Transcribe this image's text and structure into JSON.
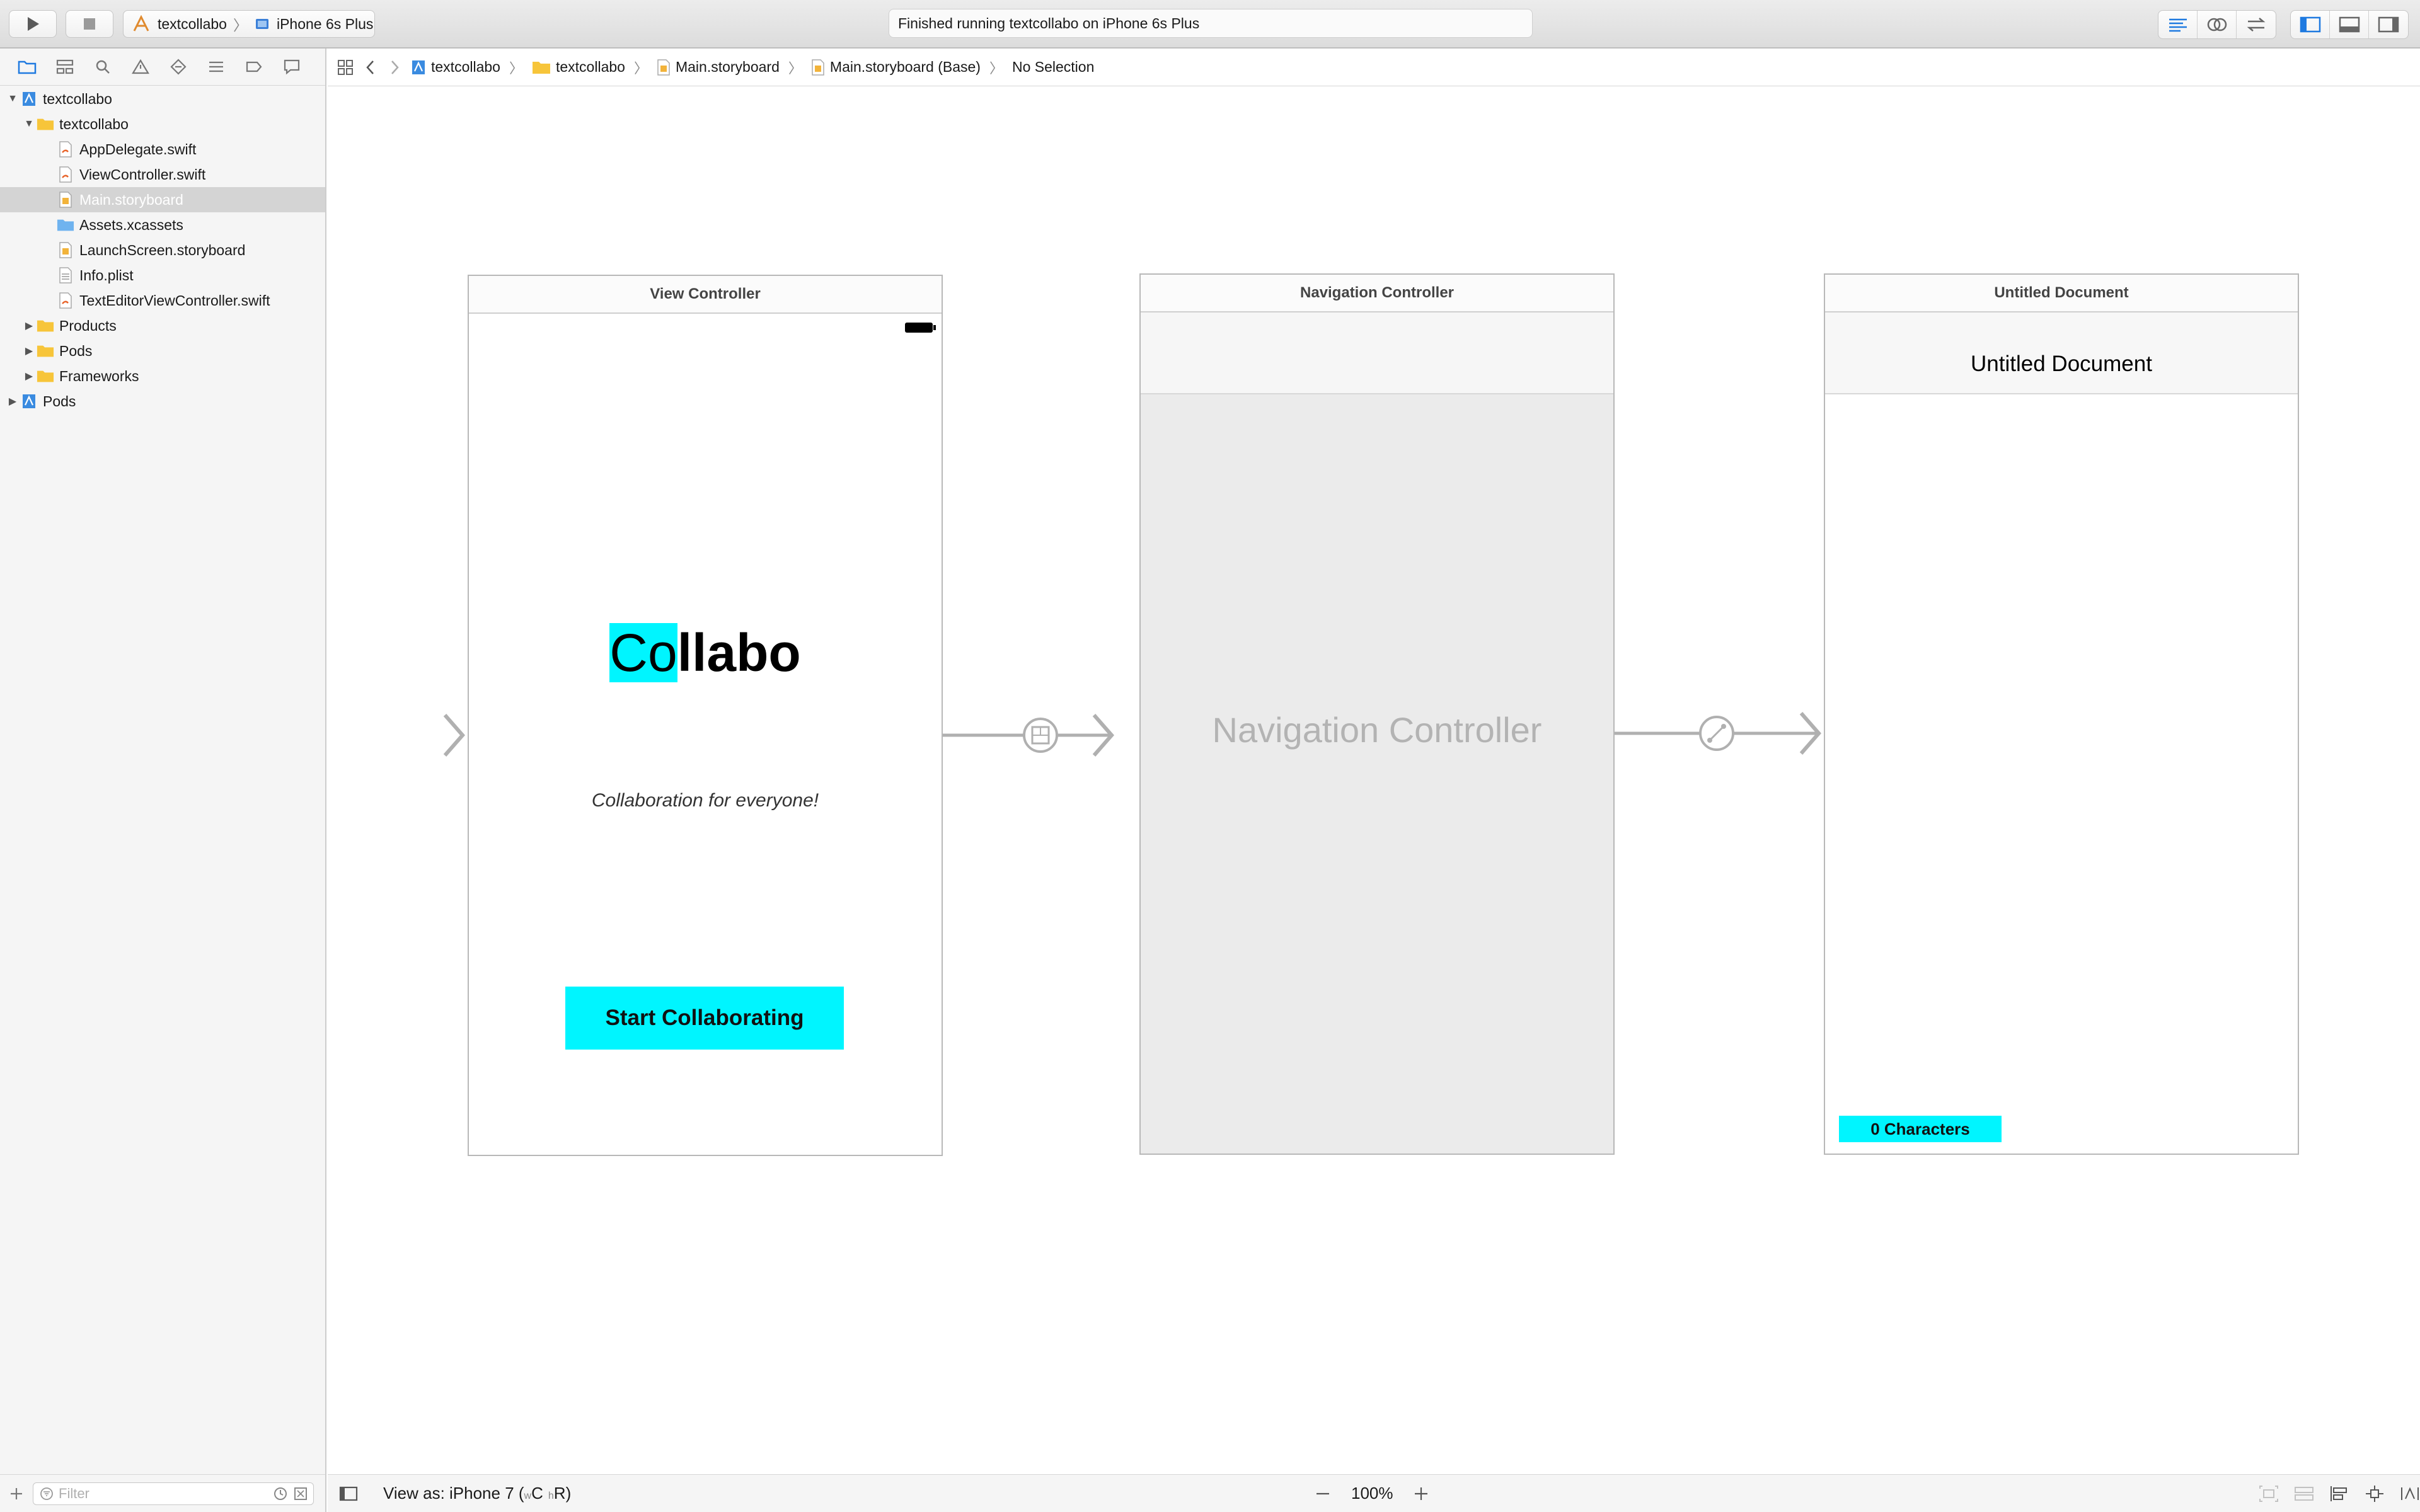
{
  "toolbar": {
    "scheme_name": "textcollabo",
    "device_name": "iPhone 6s Plus",
    "status": "Finished running textcollabo on iPhone 6s Plus"
  },
  "navigator": {
    "items": [
      {
        "label": "textcollabo",
        "icon": "project-icon"
      },
      {
        "label": "textcollabo",
        "icon": "folder-icon"
      },
      {
        "label": "AppDelegate.swift",
        "icon": "swift-file-icon"
      },
      {
        "label": "ViewController.swift",
        "icon": "swift-file-icon"
      },
      {
        "label": "Main.storyboard",
        "icon": "storyboard-file-icon"
      },
      {
        "label": "Assets.xcassets",
        "icon": "assets-folder-icon"
      },
      {
        "label": "LaunchScreen.storyboard",
        "icon": "storyboard-file-icon"
      },
      {
        "label": "Info.plist",
        "icon": "plist-file-icon"
      },
      {
        "label": "TextEditorViewController.swift",
        "icon": "swift-file-icon"
      },
      {
        "label": "Products",
        "icon": "folder-icon"
      },
      {
        "label": "Pods",
        "icon": "folder-icon"
      },
      {
        "label": "Frameworks",
        "icon": "folder-icon"
      },
      {
        "label": "Pods",
        "icon": "project-icon"
      }
    ],
    "filter_placeholder": "Filter"
  },
  "jumpbar": {
    "crumbs": [
      "textcollabo",
      "textcollabo",
      "Main.storyboard",
      "Main.storyboard (Base)",
      "No Selection"
    ]
  },
  "scenes": {
    "view_controller": {
      "title": "View Controller",
      "app_title_highlight": "Co",
      "app_title_rest": "llabo",
      "subtitle": "Collaboration for everyone!",
      "button_label": "Start Collaborating"
    },
    "navigation_controller": {
      "title": "Navigation Controller",
      "placeholder": "Navigation Controller"
    },
    "untitled_document": {
      "title": "Untitled Document",
      "nav_title": "Untitled Document",
      "char_count": "0 Characters"
    }
  },
  "bottombar": {
    "view_as": "View as: iPhone 7 (",
    "w_size": "w",
    "w_class": "C",
    "h_size": "h",
    "h_class": "R",
    "view_as_end": ")",
    "zoom": "100%"
  },
  "colors": {
    "accent_cyan": "#00f5ff",
    "selection_blue": "#1f7ae0"
  }
}
